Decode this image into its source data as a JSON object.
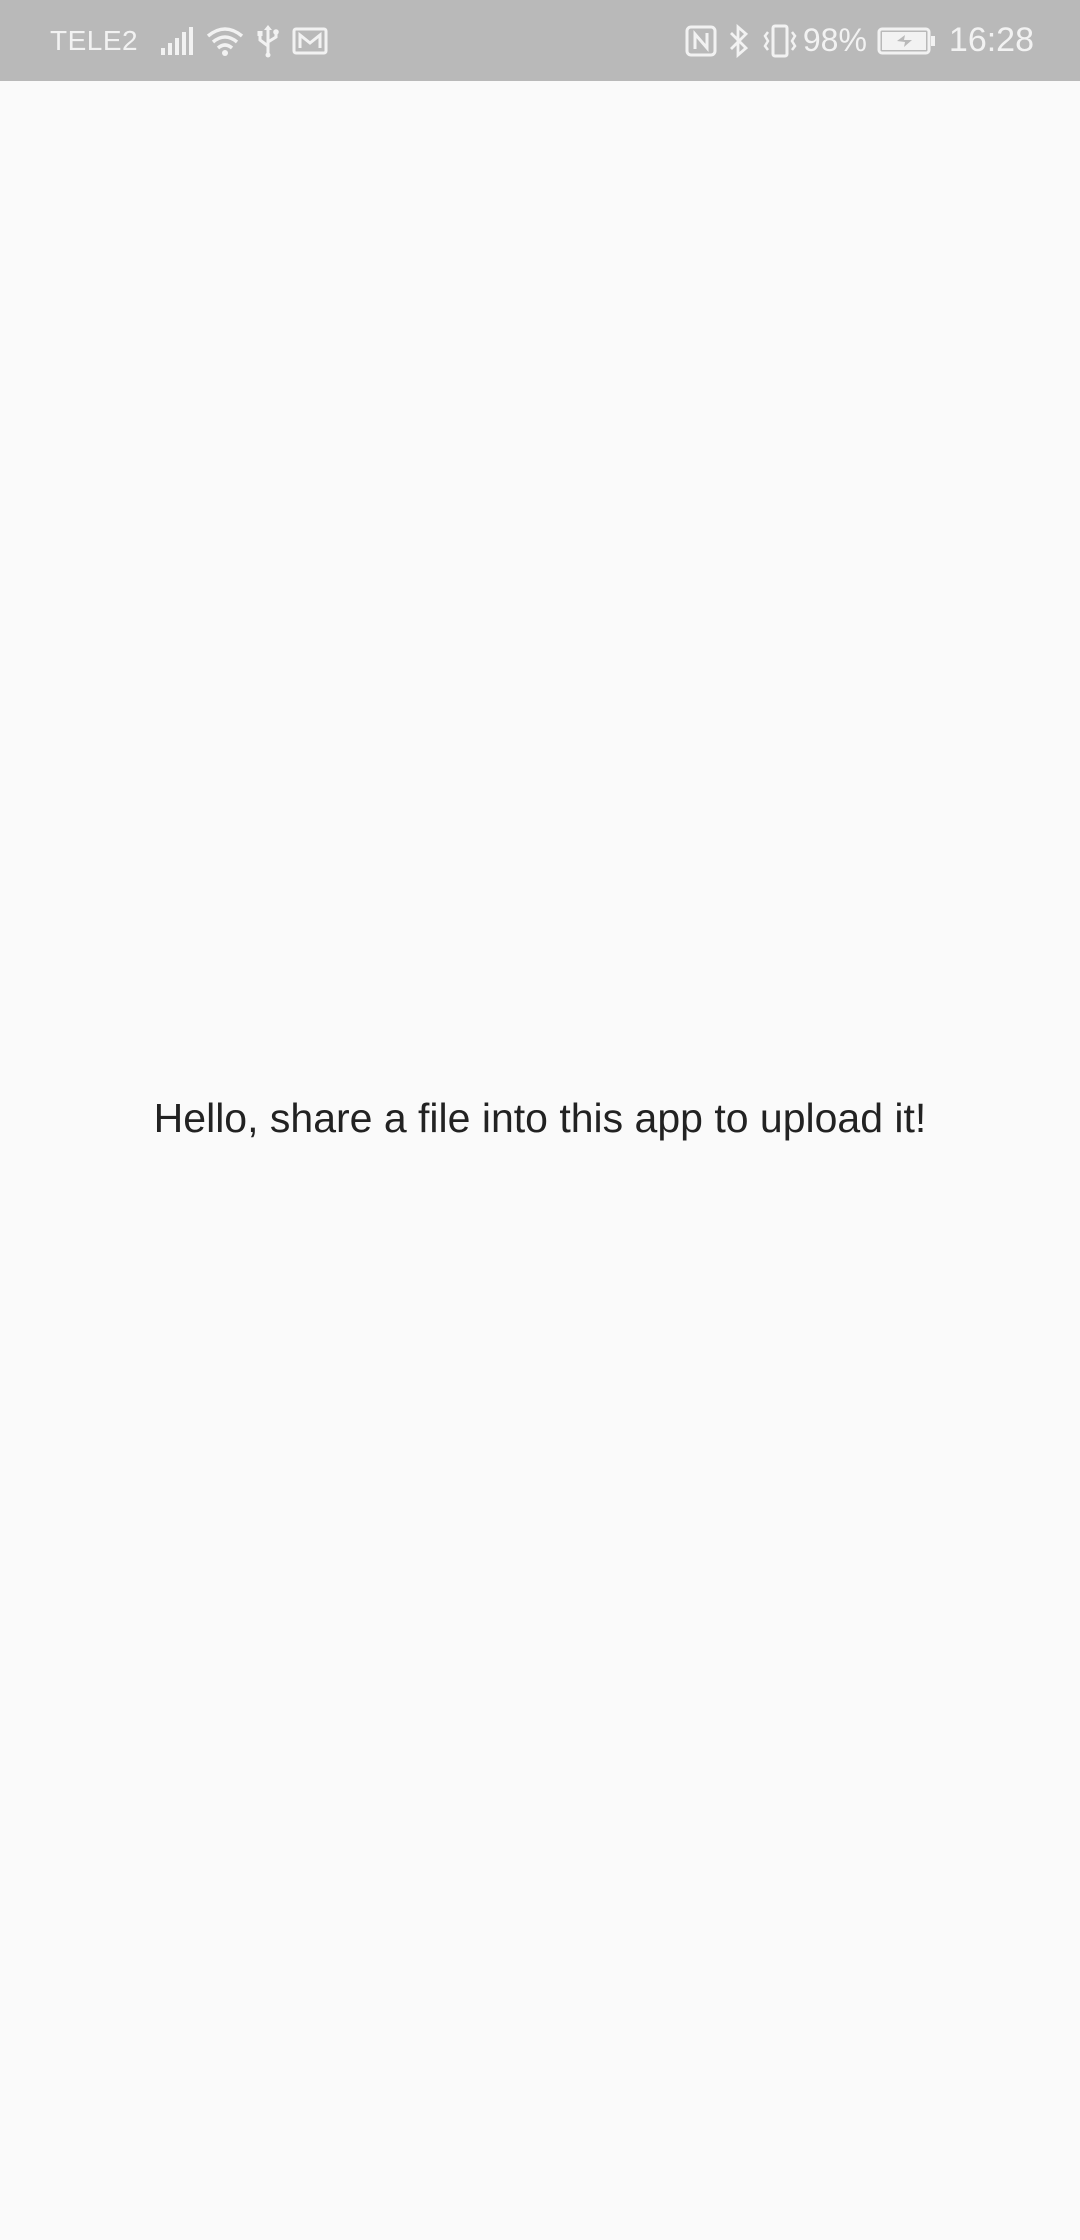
{
  "status_bar": {
    "carrier": "TELE2",
    "battery_percent": "98%",
    "time": "16:28",
    "icons_left": [
      "signal-icon",
      "wifi-icon",
      "usb-icon",
      "mail-icon"
    ],
    "icons_right": [
      "nfc-icon",
      "bluetooth-icon",
      "vibrate-icon",
      "battery-charging-icon"
    ],
    "colors": {
      "background": "#b9b9b9",
      "foreground": "#f2f2f2"
    }
  },
  "main": {
    "message": "Hello, share a file into this app to upload it!",
    "background": "#fafafa",
    "text_color": "#222222"
  }
}
